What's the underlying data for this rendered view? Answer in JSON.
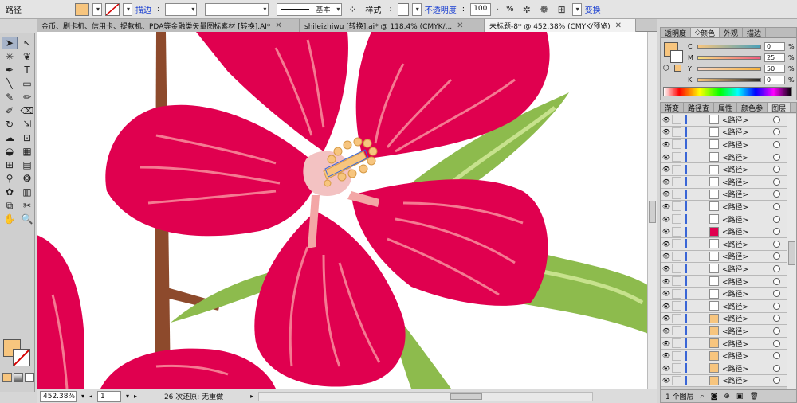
{
  "control_bar": {
    "selection_label": "路径",
    "stroke_label": "描边",
    "brush_label": "基本",
    "style_label": "样式",
    "opacity_label": "不透明度",
    "opacity_value": "100",
    "opacity_unit": "%",
    "transform_label": "变换",
    "fill_color": "#f7c57e"
  },
  "doc_tabs": [
    {
      "label": "金币、刷卡机、信用卡、提款机、PDA等金融类矢量图标素材 [转换].AI*",
      "active": false
    },
    {
      "label": "shileizhiwu [转换].ai* @ 118.4% (CMYK/...",
      "active": false
    },
    {
      "label": "未标题-8* @ 452.38% (CMYK/预览)",
      "active": true
    }
  ],
  "status_bar": {
    "zoom": "452.38%",
    "page": "1",
    "status": "26 次还原; 无重做"
  },
  "color_panel": {
    "tabs": [
      "透明度",
      "颜色",
      "外观",
      "描边"
    ],
    "active_tab": "颜色",
    "sliders": [
      {
        "key": "C",
        "value": "0",
        "unit": "%",
        "gradient": "linear-gradient(to right,#f7c57e,#4aa0b8)"
      },
      {
        "key": "M",
        "value": "25",
        "unit": "%",
        "gradient": "linear-gradient(to right,#f7e07e,#f05a7e)"
      },
      {
        "key": "Y",
        "value": "50",
        "unit": "%",
        "gradient": "linear-gradient(to right,#f7d6c4,#f7b23a)"
      },
      {
        "key": "K",
        "value": "0",
        "unit": "%",
        "gradient": "linear-gradient(to right,#f7c57e,#2a2a2a)"
      }
    ]
  },
  "layers_panel": {
    "tabs": [
      "渐变",
      "路径查",
      "属性",
      "颜色参",
      "图层"
    ],
    "active_tab": "图层",
    "item_label": "<路径>",
    "rows": [
      {
        "name": "<路径>",
        "thumb": "white"
      },
      {
        "name": "<路径>",
        "thumb": "white"
      },
      {
        "name": "<路径>",
        "thumb": "white"
      },
      {
        "name": "<路径>",
        "thumb": "white"
      },
      {
        "name": "<路径>",
        "thumb": "white"
      },
      {
        "name": "<路径>",
        "thumb": "white"
      },
      {
        "name": "<路径>",
        "thumb": "white"
      },
      {
        "name": "<路径>",
        "thumb": "white"
      },
      {
        "name": "<路径>",
        "thumb": "white"
      },
      {
        "name": "<路径>",
        "thumb": "pink"
      },
      {
        "name": "<路径>",
        "thumb": "white"
      },
      {
        "name": "<路径>",
        "thumb": "white"
      },
      {
        "name": "<路径>",
        "thumb": "white"
      },
      {
        "name": "<路径>",
        "thumb": "white"
      },
      {
        "name": "<路径>",
        "thumb": "white"
      },
      {
        "name": "<路径>",
        "thumb": "white"
      },
      {
        "name": "<路径>",
        "thumb": "orange"
      },
      {
        "name": "<路径>",
        "thumb": "orange"
      },
      {
        "name": "<路径>",
        "thumb": "orange"
      },
      {
        "name": "<路径>",
        "thumb": "orange"
      },
      {
        "name": "<路径>",
        "thumb": "orange"
      },
      {
        "name": "<路径>",
        "thumb": "orange"
      }
    ],
    "footer_text": "1 个图层"
  },
  "artwork_colors": {
    "petal": "#e0004f",
    "petal_highlight": "#f47a92",
    "leaf": "#8dbb4d",
    "leaf_highlight": "#c7e28d",
    "stem": "#8d4a2c",
    "center": "#f3c2c2",
    "stamen": "#f7c57e"
  }
}
